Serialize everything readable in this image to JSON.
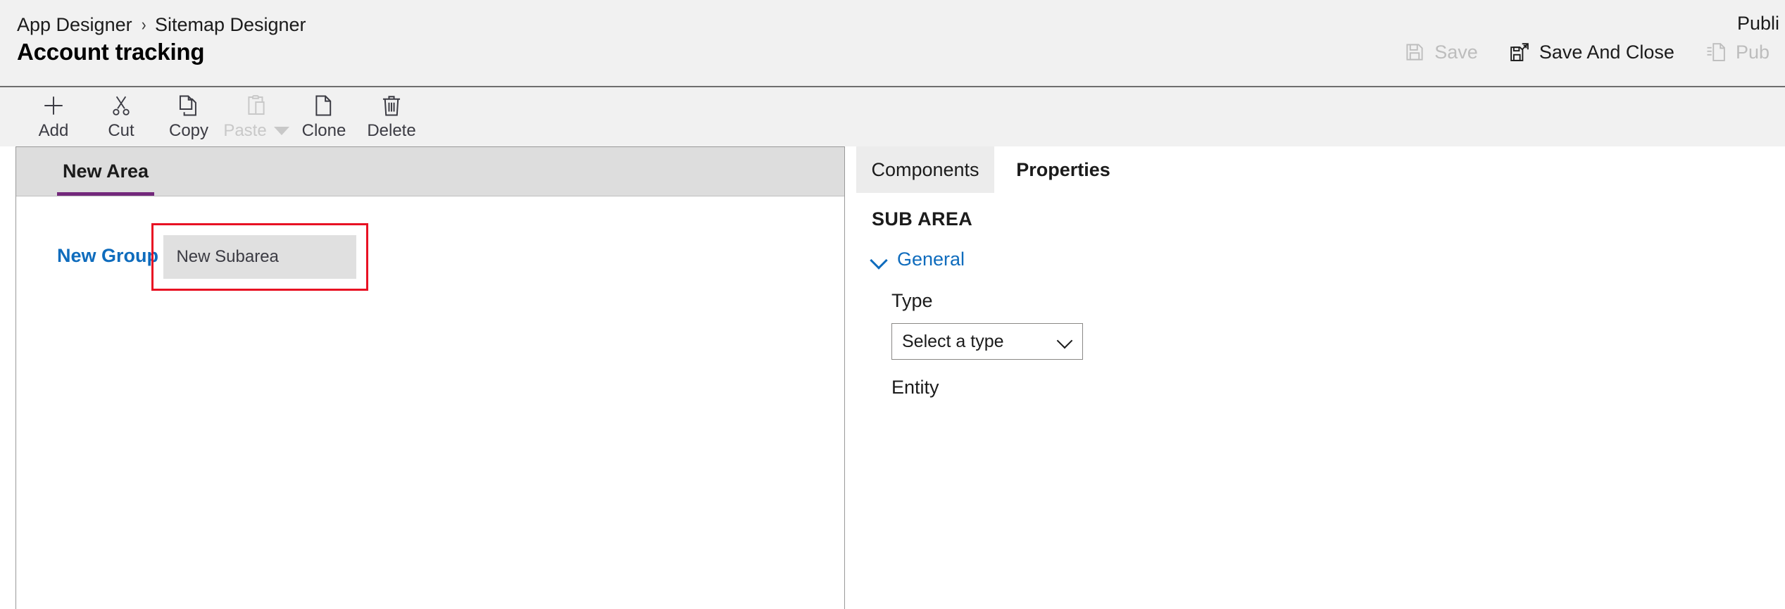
{
  "header": {
    "breadcrumb": [
      "App Designer",
      "Sitemap Designer"
    ],
    "breadcrumb_separator": "›",
    "title": "Account tracking",
    "publish_note": "Publi",
    "commands": [
      {
        "label": "Save",
        "icon": "save-icon",
        "disabled": true
      },
      {
        "label": "Save And Close",
        "icon": "save-and-close-icon",
        "disabled": false
      },
      {
        "label": "Pub",
        "icon": "publish-icon",
        "disabled": true
      }
    ]
  },
  "toolbar": {
    "buttons": [
      {
        "label": "Add",
        "icon": "plus-icon",
        "disabled": false,
        "caret": false
      },
      {
        "label": "Cut",
        "icon": "scissors-icon",
        "disabled": false,
        "caret": false
      },
      {
        "label": "Copy",
        "icon": "copy-icon",
        "disabled": false,
        "caret": false
      },
      {
        "label": "Paste",
        "icon": "clipboard-icon",
        "disabled": true,
        "caret": true
      },
      {
        "label": "Clone",
        "icon": "clone-icon",
        "disabled": false,
        "caret": false
      },
      {
        "label": "Delete",
        "icon": "trash-icon",
        "disabled": false,
        "caret": false
      }
    ]
  },
  "canvas": {
    "area_tabs": [
      {
        "label": "New Area",
        "active": true
      }
    ],
    "group": {
      "label": "New Group"
    },
    "subarea": {
      "label": "New Subarea",
      "selected": true,
      "error": true
    }
  },
  "panel": {
    "tabs": [
      {
        "label": "Components",
        "active": false
      },
      {
        "label": "Properties",
        "active": true
      }
    ],
    "heading": "SUB AREA",
    "section": {
      "label": "General",
      "expanded": true
    },
    "fields": [
      {
        "label": "Type",
        "control": "select",
        "value": "Select a type"
      },
      {
        "label": "Entity",
        "control": "select",
        "value": ""
      }
    ]
  },
  "colors": {
    "accent_purple": "#73287b",
    "link_blue": "#0f6cbd",
    "error_red": "#e81123",
    "chrome_gray": "#f1f1f1",
    "tab_gray": "#dddddd"
  }
}
